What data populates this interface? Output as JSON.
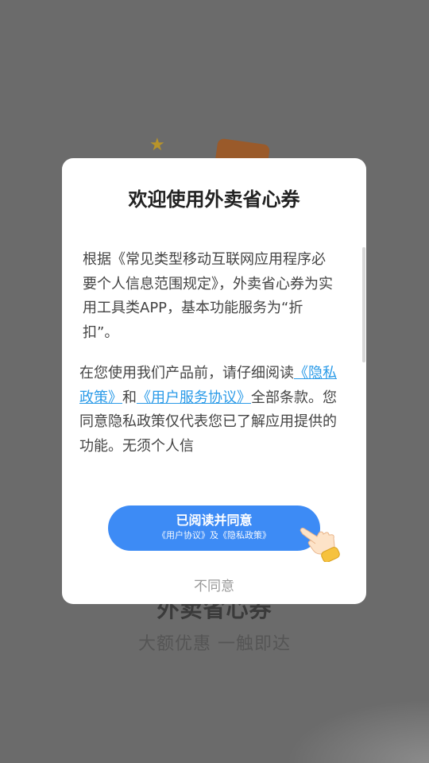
{
  "background": {
    "app_name": "外卖省心券",
    "slogan": "大额优惠 一触即达"
  },
  "dialog": {
    "title": "欢迎使用外卖省心券",
    "para1": "根据《常见类型移动互联网应用程序必要个人信息范围规定》，外卖省心券为实用工具类APP，基本功能服务为“折扣”。",
    "para2_prefix": "在您使用我们产品前，请仔细阅读",
    "privacy_link": "《隐私政策》",
    "and_text": "和",
    "user_agreement_link": "《用户服务协议》",
    "para2_suffix": "全部条款。您同意隐私政策仅代表您已了解应用提供的功能。无须个人信",
    "agree_button": {
      "label": "已阅读并同意",
      "sub_label": "《用户协议》及《隐私政策》"
    },
    "disagree_label": "不同意"
  },
  "colors": {
    "overlay": "#6b6b6b",
    "dialog_bg": "#ffffff",
    "primary_button": "#3d8bf5",
    "link": "#2b9be8",
    "disagree_text": "#999999"
  },
  "icons": [
    "star-icon",
    "pointing-hand-icon"
  ]
}
